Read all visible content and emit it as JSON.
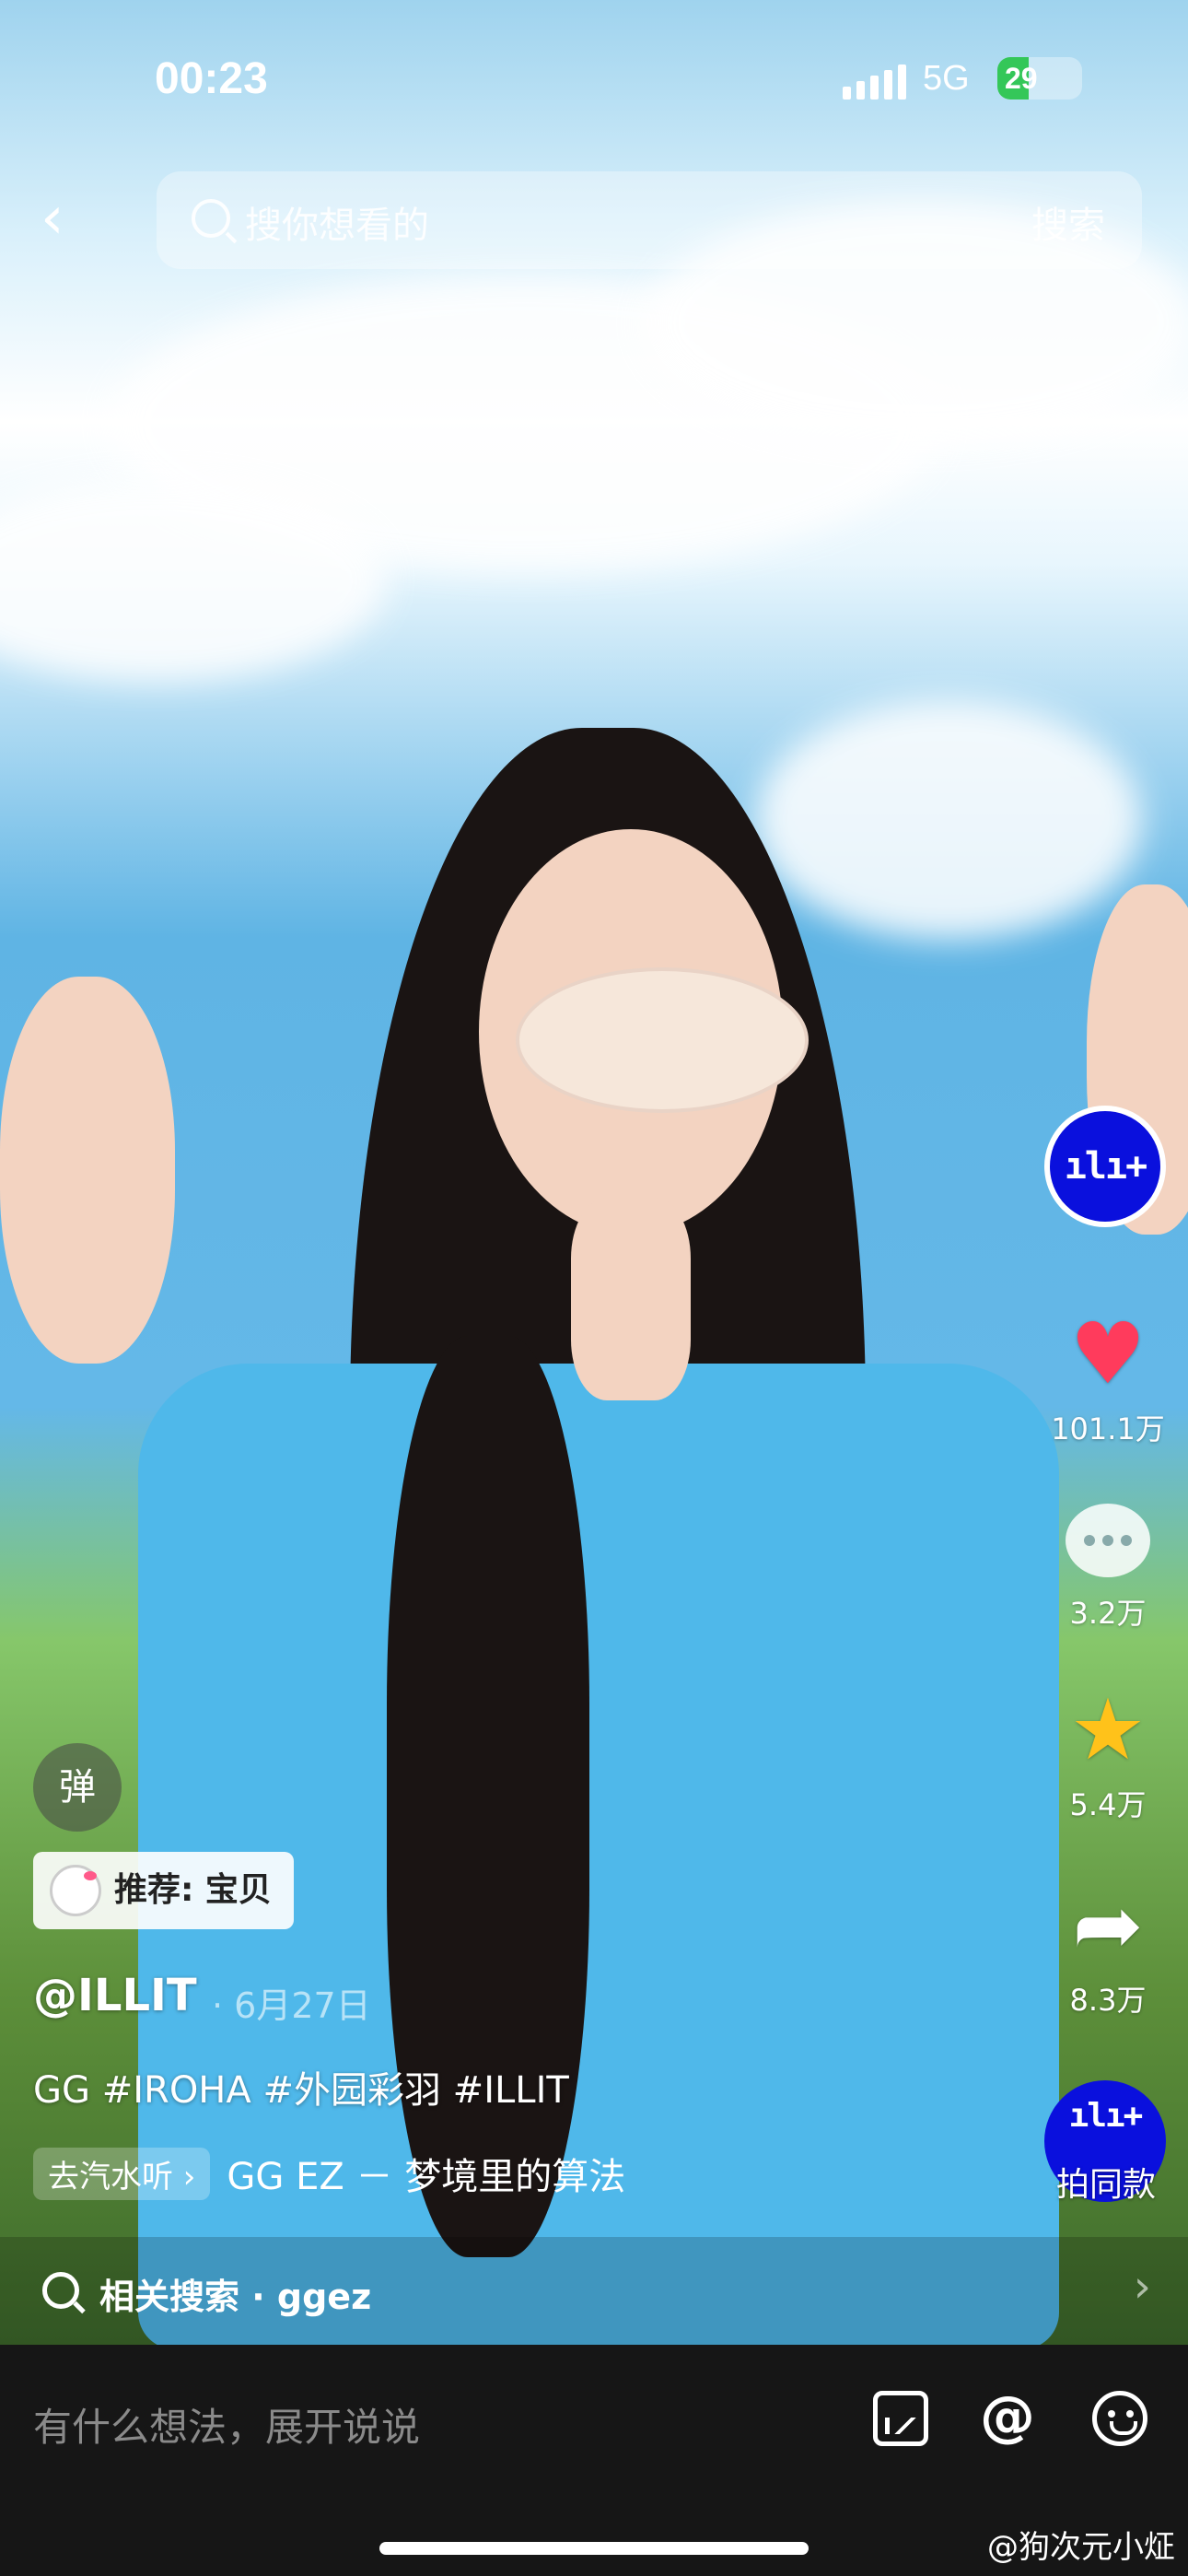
{
  "status_bar": {
    "time": "00:23",
    "network": "5G",
    "battery": "29"
  },
  "search": {
    "placeholder": "搜你想看的",
    "button": "搜索"
  },
  "actions": {
    "avatar_logo": "ılı+",
    "likes": "101.1万",
    "comments": "3.2万",
    "favorites": "5.4万",
    "shares": "8.3万",
    "same_style_logo": "ılı+",
    "same_style_label": "拍同款"
  },
  "danmu_button": "弹",
  "recommend_tag": "推荐: 宝贝",
  "post": {
    "author": "@ILLIT",
    "date": "· 6月27日",
    "caption": "GG #IROHA #外园彩羽 #ILLIT",
    "music_go": "去汽水听 ›",
    "music_title": "GG EZ － 梦境里的算法"
  },
  "related_search": {
    "label": "相关搜索 · ggez"
  },
  "comment_bar": {
    "placeholder": "有什么想法，展开说说"
  },
  "watermark": "@狗次元小炡",
  "colors": {
    "like": "#ff3b5c",
    "favorite": "#ffc21a",
    "brand_blue": "#0a10dd",
    "battery_green": "#34c759"
  },
  "icons": [
    "back-icon",
    "search-icon",
    "heart-icon",
    "comment-icon",
    "star-icon",
    "share-icon",
    "image-icon",
    "at-icon",
    "emoji-icon"
  ]
}
